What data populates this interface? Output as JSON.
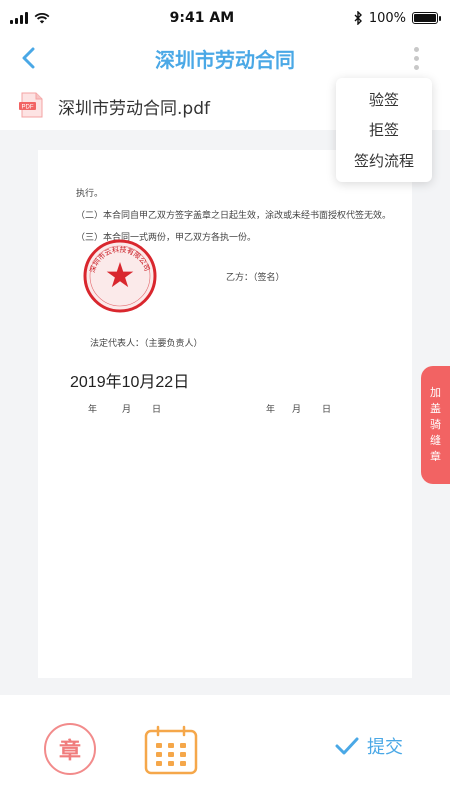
{
  "status_bar": {
    "time": "9:41 AM",
    "battery": "100%",
    "battery_level": 1.0
  },
  "nav": {
    "title": "深圳市劳动合同",
    "back_icon": "chevron-left-icon",
    "more_icon": "more-vertical-icon"
  },
  "file": {
    "name": "深圳市劳动合同.pdf",
    "icon_label": "PDF"
  },
  "menu": {
    "items": [
      "验签",
      "拒签",
      "签约流程"
    ]
  },
  "document": {
    "lines": [
      "执行。",
      "（二）本合同自甲乙双方签字盖章之日起生效，涂改或未经书面授权代签无效。",
      "（三）本合同一式两份，甲乙双方各执一份。",
      "乙方：（签名）",
      "法定代表人：（主要负责人）"
    ],
    "seal_text": "深圳市云科技有限公司",
    "signed_date": "2019年10月22日",
    "date_row_a": [
      "年",
      "月",
      "日"
    ],
    "date_row_b": [
      "年",
      "月",
      "日"
    ]
  },
  "side_tab": {
    "chars": [
      "加",
      "盖",
      "骑",
      "缝",
      "章"
    ]
  },
  "bottom": {
    "seal_label": "章",
    "submit_label": "提交"
  },
  "colors": {
    "accent": "#4aa8e6",
    "seal_red": "#f26363",
    "calendar_orange": "#f5a74a"
  }
}
